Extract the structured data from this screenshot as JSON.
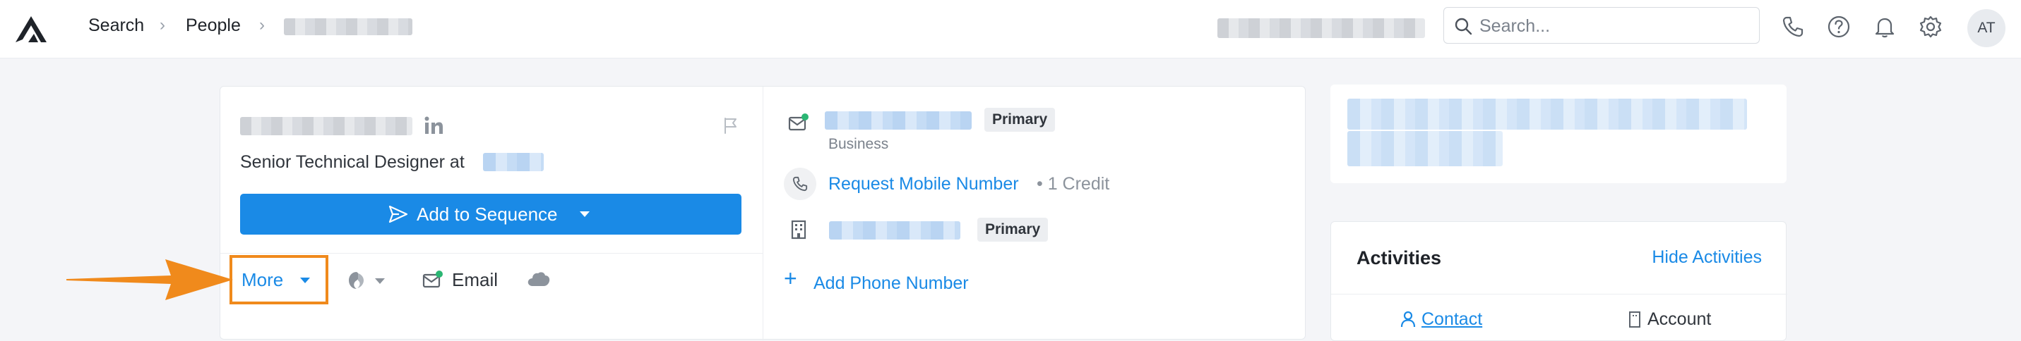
{
  "topbar": {
    "breadcrumb": [
      "Search",
      "People"
    ],
    "search_placeholder": "Search...",
    "avatar_initials": "AT",
    "icons": [
      "phone-icon",
      "help-icon",
      "bell-icon",
      "gear-icon"
    ]
  },
  "profile": {
    "title": "Senior Technical Designer at",
    "add_to_sequence": "Add to Sequence",
    "more": "More",
    "email": "Email"
  },
  "contact": {
    "email_badge": "Primary",
    "email_type": "Business",
    "request_mobile": "Request Mobile Number",
    "credit": "• 1 Credit",
    "phone_badge": "Primary",
    "add_phone": "Add Phone Number"
  },
  "activities": {
    "title": "Activities",
    "hide": "Hide Activities",
    "tab_contact": "Contact",
    "tab_account": "Account"
  },
  "colors": {
    "accent": "#1a8ae6",
    "highlight": "#f08a1c",
    "online": "#2bb673"
  }
}
